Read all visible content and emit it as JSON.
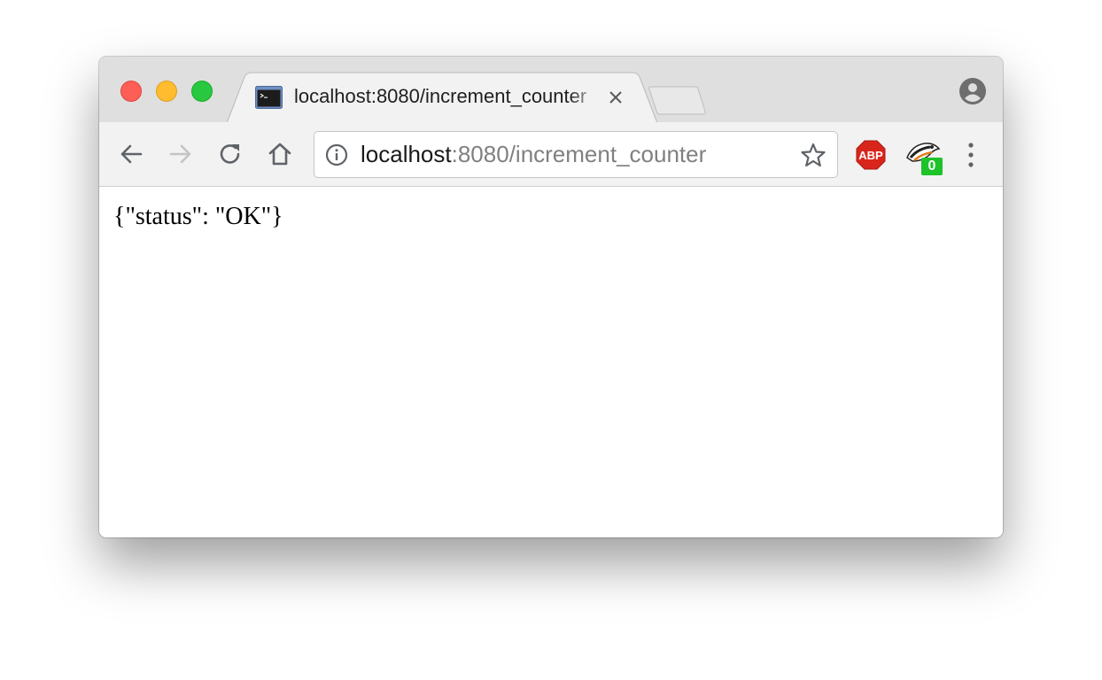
{
  "window": {
    "controls": [
      "close",
      "minimize",
      "maximize"
    ]
  },
  "tab": {
    "title": "localhost:8080/increment_counter",
    "favicon": "terminal-icon"
  },
  "toolbar": {
    "back_icon": "back-arrow-icon",
    "forward_icon": "forward-arrow-icon",
    "reload_icon": "reload-icon",
    "home_icon": "home-icon"
  },
  "omnibox": {
    "host": "localhost",
    "rest": ":8080/increment_counter",
    "info_icon": "info-icon",
    "bookmark_icon": "star-icon"
  },
  "extensions": {
    "adblock_label": "ABP",
    "badger_count": "0"
  },
  "page": {
    "body_text": "{\"status\": \"OK\"}"
  },
  "colors": {
    "close": "#fd5f57",
    "minimize": "#febc2e",
    "maximize": "#28c840",
    "abp_red": "#d9261c",
    "badge_green": "#1ec229"
  }
}
